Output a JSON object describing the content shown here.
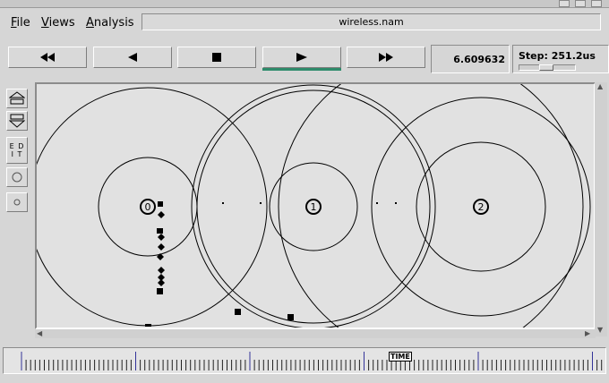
{
  "menu": {
    "file_prefix": "",
    "file_hot": "F",
    "file_rest": "ile",
    "views_prefix": "",
    "views_hot": "V",
    "views_rest": "iews",
    "analysis_prefix": "",
    "analysis_hot": "A",
    "analysis_rest": "nalysis"
  },
  "filename": "wireless.nam",
  "controls": {
    "rewind": "fast-rewind-icon",
    "back": "step-back-icon",
    "stop": "stop-icon",
    "play": "play-icon",
    "forward": "fast-forward-icon",
    "active": "play"
  },
  "time_display": "6.609632",
  "step": {
    "label": "Step: 251.2us"
  },
  "tools": {
    "edit_label_1": "E D",
    "edit_label_2": "I T"
  },
  "nodes": [
    {
      "id": "0"
    },
    {
      "id": "1"
    },
    {
      "id": "2"
    }
  ],
  "timeline": {
    "marker_label": "TIME"
  },
  "colors": {
    "play_indicator": "#2e8b6b",
    "canvas_bg": "#e1e1e1"
  }
}
